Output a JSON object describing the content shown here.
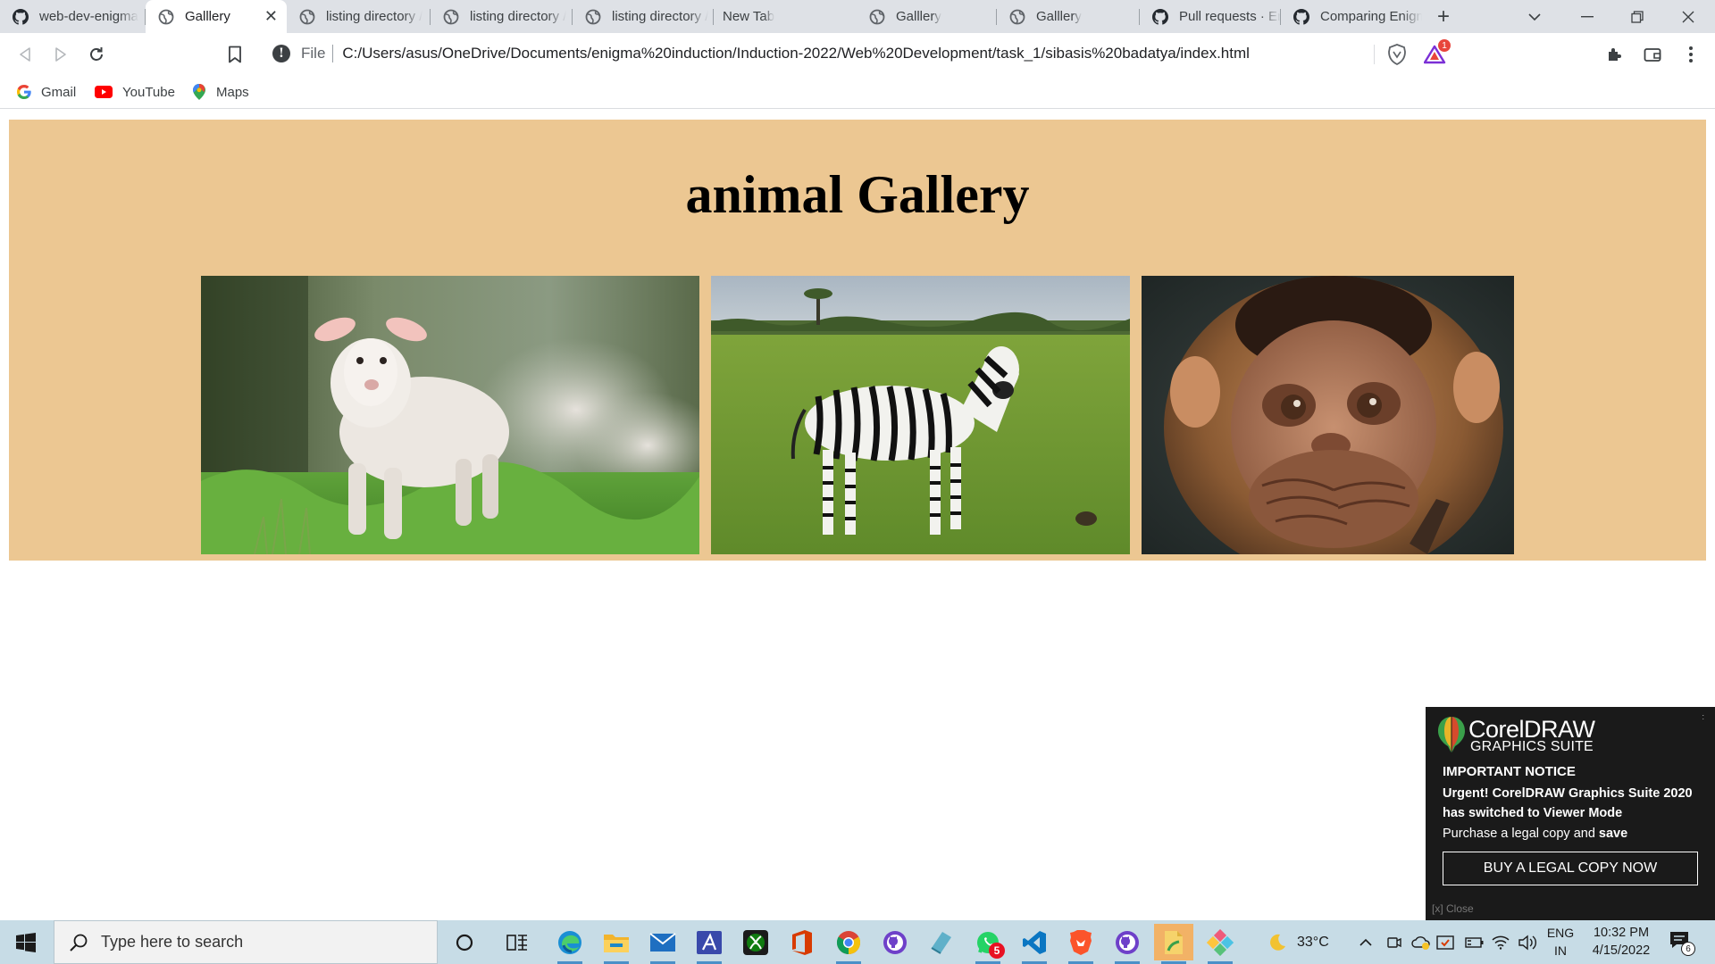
{
  "browser": {
    "tabs": [
      {
        "title": "web-dev-enigma",
        "favicon": "github-icon",
        "active": false
      },
      {
        "title": "Galllery",
        "favicon": "globe-icon",
        "active": true
      },
      {
        "title": "listing directory /",
        "favicon": "globe-icon",
        "active": false
      },
      {
        "title": "listing directory /",
        "favicon": "globe-icon",
        "active": false
      },
      {
        "title": "listing directory /",
        "favicon": "globe-icon",
        "active": false
      },
      {
        "title": "New Tab",
        "favicon": "none",
        "active": false
      },
      {
        "title": "Galllery",
        "favicon": "globe-icon",
        "active": false
      },
      {
        "title": "Galllery",
        "favicon": "globe-icon",
        "active": false
      },
      {
        "title": "Pull requests · En",
        "favicon": "github-icon",
        "active": false
      },
      {
        "title": "Comparing Enigm",
        "favicon": "github-icon",
        "active": false
      }
    ],
    "address_bar": {
      "scheme_label": "File",
      "url": "C:/Users/asus/OneDrive/Documents/enigma%20induction/Induction-2022/Web%20Development/task_1/sibasis%20badatya/index.html"
    },
    "rewards_badge": "1",
    "bookmarks": [
      {
        "label": "Gmail",
        "icon": "google-icon"
      },
      {
        "label": "YouTube",
        "icon": "youtube-icon"
      },
      {
        "label": "Maps",
        "icon": "maps-pin-icon"
      }
    ]
  },
  "page": {
    "heading": "animal Gallery",
    "background_color": "#ecc792",
    "images": [
      {
        "subject": "lamb",
        "alt": "lamb"
      },
      {
        "subject": "zebra",
        "alt": "zebra"
      },
      {
        "subject": "monkey",
        "alt": "monkey"
      }
    ]
  },
  "notice": {
    "brand_line1": "CorelDRAW",
    "brand_line2": "GRAPHICS SUITE",
    "heading": "IMPORTANT NOTICE",
    "message": "Urgent! CorelDRAW Graphics Suite 2020 has switched to Viewer Mode",
    "purchase_prefix": "Purchase a legal copy and ",
    "purchase_bold": "save",
    "button_label": "BUY A LEGAL COPY NOW",
    "close_label": "[x] Close"
  },
  "taskbar": {
    "search_placeholder": "Type here to search",
    "whatsapp_badge": "5",
    "weather_temp": "33°C",
    "language_line1": "ENG",
    "language_line2": "IN",
    "time": "10:32 PM",
    "date": "4/15/2022",
    "notification_count": "6"
  }
}
